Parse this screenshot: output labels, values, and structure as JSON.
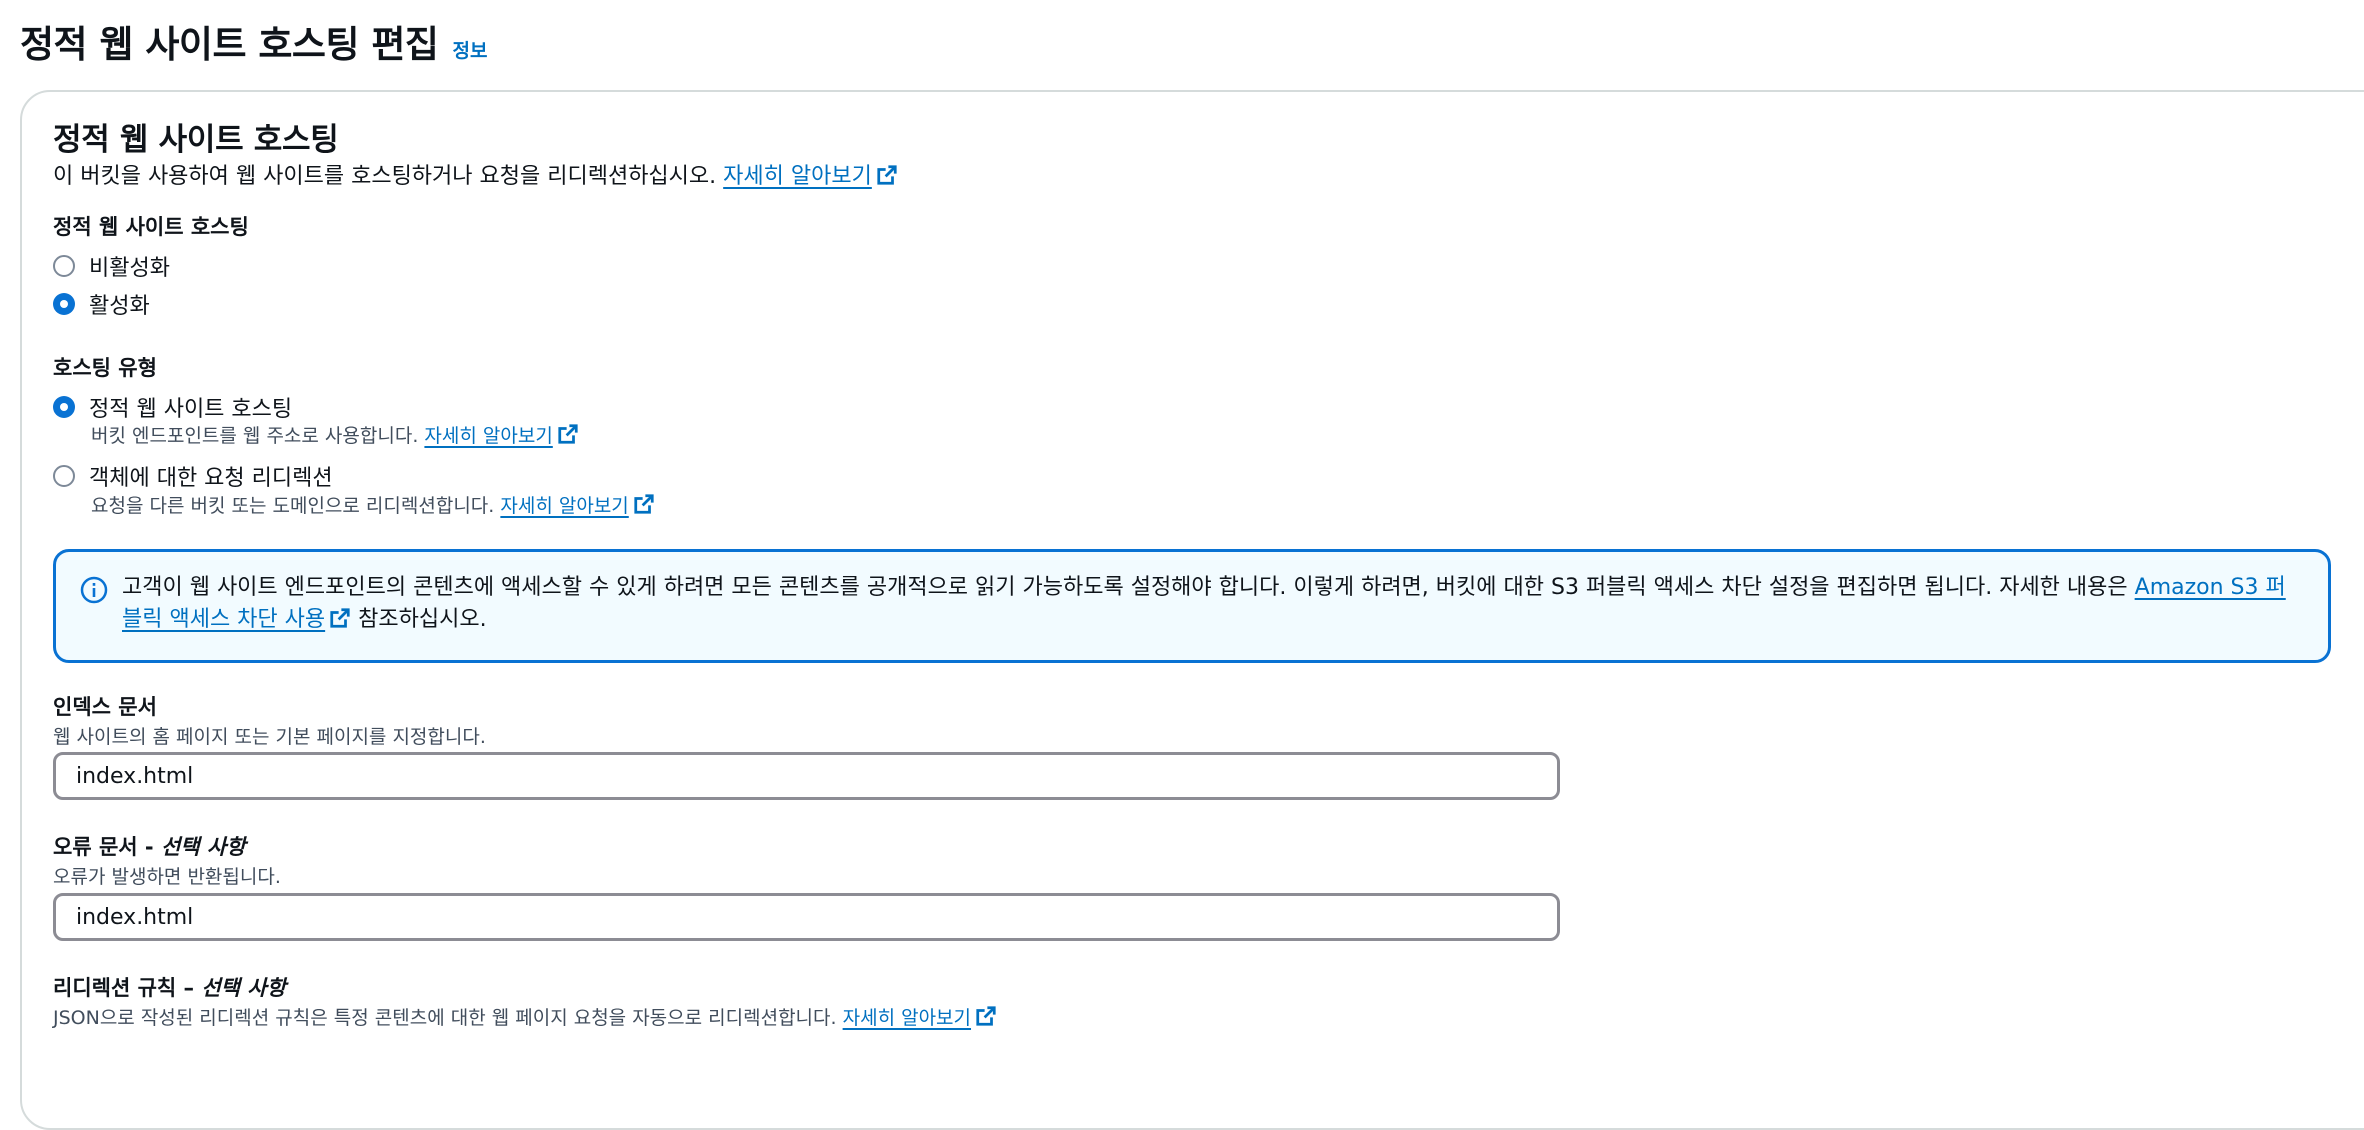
{
  "page": {
    "title": "정적 웹 사이트 호스팅 편집",
    "info_link": "정보"
  },
  "section": {
    "heading": "정적 웹 사이트 호스팅",
    "description": "이 버킷을 사용하여 웹 사이트를 호스팅하거나 요청을 리디렉션하십시오.",
    "learn_more": "자세히 알아보기"
  },
  "hosting_toggle": {
    "label": "정적 웹 사이트 호스팅",
    "options": [
      {
        "label": "비활성화",
        "checked": false
      },
      {
        "label": "활성화",
        "checked": true
      }
    ]
  },
  "hosting_type": {
    "label": "호스팅 유형",
    "options": [
      {
        "label": "정적 웹 사이트 호스팅",
        "description": "버킷 엔드포인트를 웹 주소로 사용합니다.",
        "learn_more": "자세히 알아보기",
        "checked": true
      },
      {
        "label": "객체에 대한 요청 리디렉션",
        "description": "요청을 다른 버킷 또는 도메인으로 리디렉션합니다.",
        "learn_more": "자세히 알아보기",
        "checked": false
      }
    ]
  },
  "alert": {
    "text_before": "고객이 웹 사이트 엔드포인트의 콘텐츠에 액세스할 수 있게 하려면 모든 콘텐츠를 공개적으로 읽기 가능하도록 설정해야 합니다. 이렇게 하려면, 버킷에 대한 S3 퍼블릭 액세스 차단 설정을 편집하면 됩니다. 자세한 내용은 ",
    "link": "Amazon S3 퍼블릭 액세스 차단 사용",
    "text_after": " 참조하십시오."
  },
  "index_document": {
    "label": "인덱스 문서",
    "description": "웹 사이트의 홈 페이지 또는 기본 페이지를 지정합니다.",
    "value": "index.html"
  },
  "error_document": {
    "label": "오류 문서 - ",
    "optional": "선택 사항",
    "description": "오류가 발생하면 반환됩니다.",
    "value": "index.html"
  },
  "redirect_rules": {
    "label": "리디렉션 규칙 – ",
    "optional": "선택 사항",
    "description": "JSON으로 작성된 리디렉션 규칙은 특정 콘텐츠에 대한 웹 페이지 요청을 자동으로 리디렉션합니다.",
    "learn_more": "자세히 알아보기"
  },
  "colors": {
    "link": "#0070c0",
    "accent": "#0972d3",
    "alert_bg": "#f2fbff"
  }
}
